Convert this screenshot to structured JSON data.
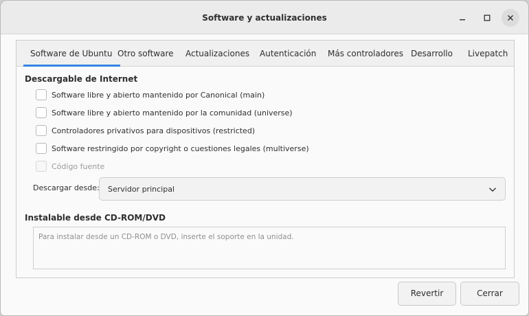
{
  "window": {
    "title": "Software y actualizaciones",
    "controls": [
      "minimize",
      "maximize",
      "close"
    ]
  },
  "tabs": [
    {
      "label": "Software de Ubuntu",
      "active": true
    },
    {
      "label": "Otro software",
      "active": false
    },
    {
      "label": "Actualizaciones",
      "active": false
    },
    {
      "label": "Autenticación",
      "active": false
    },
    {
      "label": "Más controladores",
      "active": false
    },
    {
      "label": "Desarrollo",
      "active": false
    },
    {
      "label": "Livepatch",
      "active": false
    }
  ],
  "internet": {
    "heading": "Descargable de Internet",
    "options": [
      {
        "label": "Software libre y abierto mantenido por Canonical (main)",
        "checked": false,
        "enabled": true
      },
      {
        "label": "Software libre y abierto mantenido por la comunidad (universe)",
        "checked": false,
        "enabled": true
      },
      {
        "label": "Controladores privativos para dispositivos (restricted)",
        "checked": false,
        "enabled": true
      },
      {
        "label": "Software restringido por copyright o cuestiones legales (multiverse)",
        "checked": false,
        "enabled": true
      },
      {
        "label": "Código fuente",
        "checked": false,
        "enabled": false
      }
    ],
    "download_from_label": "Descargar desde:",
    "download_from_value": "Servidor principal"
  },
  "cdrom": {
    "heading": "Instalable desde CD-ROM/DVD",
    "placeholder": "Para instalar desde un CD-ROM o DVD, inserte el soporte en la unidad."
  },
  "buttons": {
    "revert": "Revertir",
    "close": "Cerrar"
  },
  "colors": {
    "accent": "#3584e4"
  }
}
